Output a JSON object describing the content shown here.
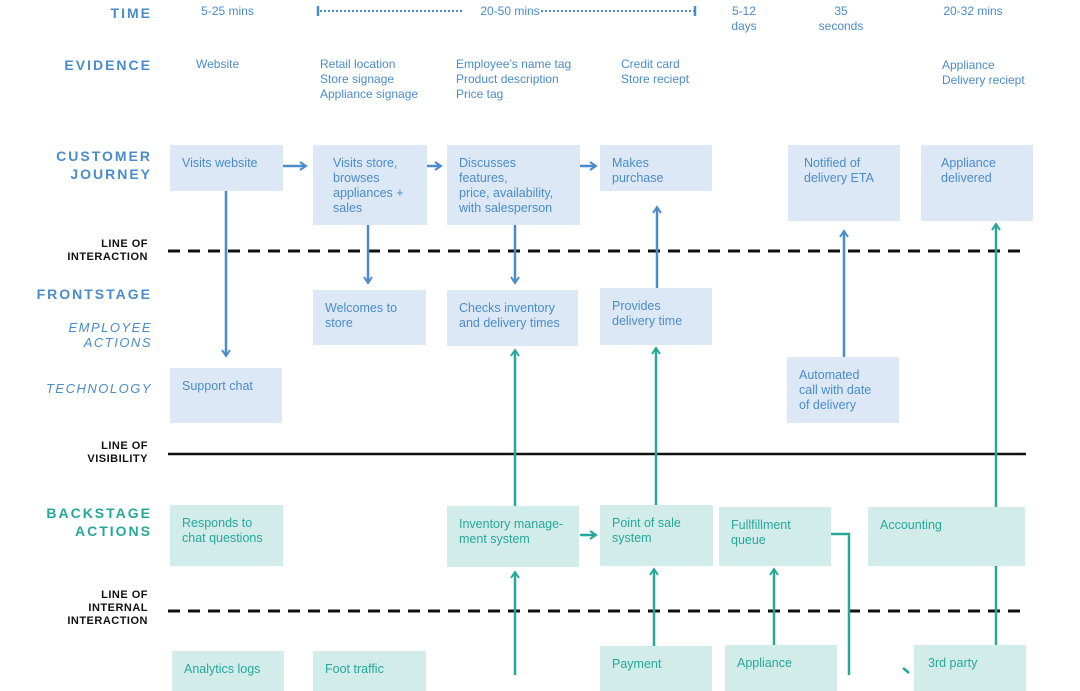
{
  "lanes": {
    "time": "TIME",
    "evidence": "EVIDENCE",
    "customer_journey": "CUSTOMER\nJOURNEY",
    "frontstage": "FRONTSTAGE",
    "employee_actions": "EMPLOYEE\nACTIONS",
    "technology": "TECHNOLOGY",
    "backstage_actions": "BACKSTAGE\nACTIONS"
  },
  "lines": {
    "interaction": "LINE OF\nINTERACTION",
    "visibility": "LINE OF\nVISIBILITY",
    "internal_interaction": "LINE OF\nINTERNAL\nINTERACTION"
  },
  "time": [
    "5-25 mins",
    "20-50 mins",
    "5-12\ndays",
    "35\nseconds",
    "20-32 mins"
  ],
  "evidence": [
    "Website",
    "Retail location\nStore signage\nAppliance signage",
    "Employee’s name tag\nProduct description\nPrice tag",
    "Credit card\nStore reciept",
    "Appliance\nDelivery reciept"
  ],
  "customer_journey": [
    "Visits website",
    "Visits store,\nbrowses\nappliances +\nsales",
    "Discusses features,\nprice, availability,\nwith salesperson",
    "Makes purchase",
    "Notified of\ndelivery ETA",
    "Appliance\ndelivered"
  ],
  "employee_actions": [
    "Welcomes to\nstore",
    "Checks inventory\nand delivery times",
    "Provides\ndelivery time"
  ],
  "technology": [
    "Support chat",
    "Automated\ncall with date\nof delivery"
  ],
  "backstage_actions": [
    "Responds to\nchat questions",
    "Inventory manage-\nment system",
    "Point of sale\nsystem",
    "Fullfillment\nqueue",
    "Accounting"
  ],
  "support_processes": [
    "Analytics logs",
    "Foot traffic",
    "Payment",
    "Appliance",
    "3rd party"
  ],
  "colors": {
    "frontstage_blue": "#4a8ccb",
    "frontstage_fill": "#dce8f5",
    "backstage_teal": "#25a89a",
    "backstage_fill": "#d2ecea",
    "line": "#111111"
  }
}
